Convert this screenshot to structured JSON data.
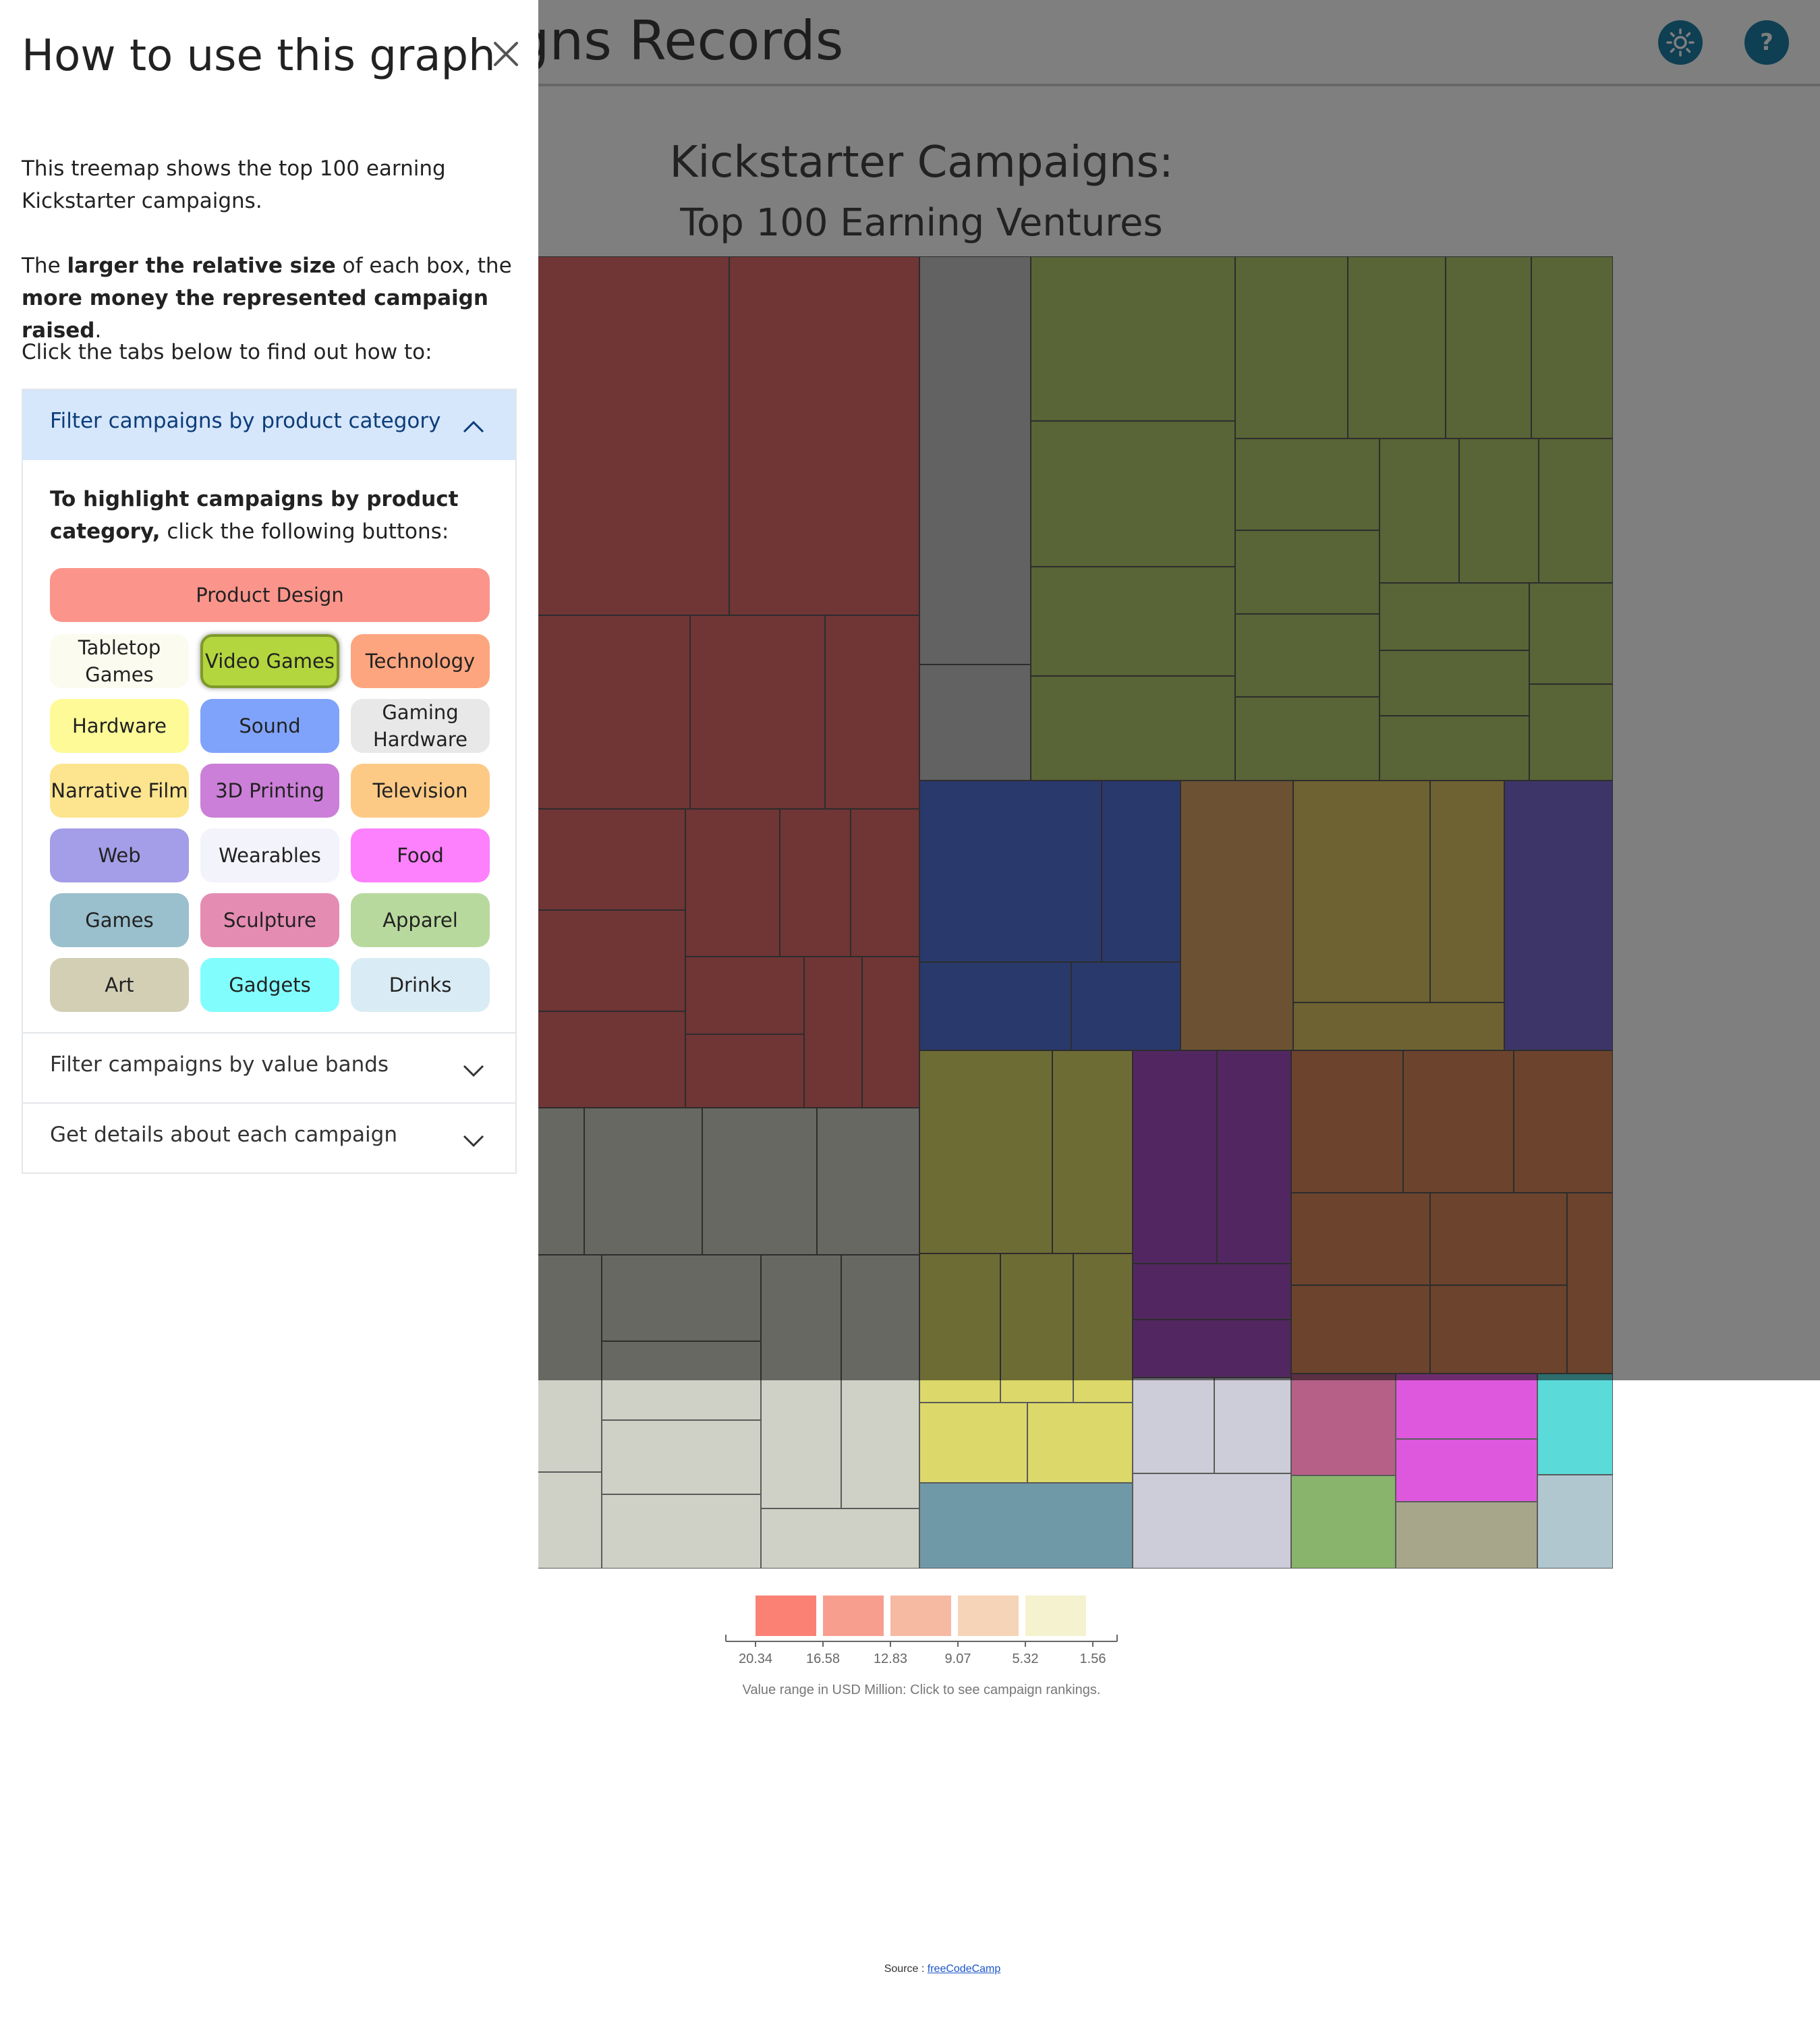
{
  "header": {
    "title": "Kickstarter Campaigns Records",
    "theme_icon": "sun-icon",
    "help_icon": "question-icon",
    "help_label": "?"
  },
  "chart_data": {
    "type": "treemap",
    "title": "Kickstarter Campaigns:",
    "subtitle": "Top 100 Earning Ventures",
    "legend": {
      "ticks": [
        "20.34",
        "16.58",
        "12.83",
        "9.07",
        "5.32",
        "1.56"
      ],
      "colors": [
        "#fa8174",
        "#f89e8f",
        "#f6b9a2",
        "#f6d4b7",
        "#f5f2cf"
      ],
      "caption": "Value range in USD Million: Click to see campaign rankings."
    }
  },
  "source": {
    "prefix": "Source : ",
    "link": "freeCodeCamp"
  },
  "panel": {
    "title": "How to use this graph",
    "close_icon": "close-icon",
    "intro": "This treemap shows the top 100 earning Kickstarter campaigns.",
    "size_prefix": "The ",
    "size_bold1": "larger the relative size",
    "size_mid": " of each box, the ",
    "size_bold2": "more money the represented campaign raised",
    "size_suffix": ".",
    "tabs_intro": "Click the tabs below to find out how to:",
    "accordion": [
      {
        "label": "Filter campaigns by product category",
        "expanded": true,
        "body_bold": "To highlight campaigns by product category,",
        "body_rest": " click the following buttons:"
      },
      {
        "label": "Filter campaigns by value bands",
        "expanded": false
      },
      {
        "label": "Get details about each campaign",
        "expanded": false
      }
    ],
    "categories": [
      {
        "label": "Product Design",
        "color": "#fb958b"
      },
      {
        "label": "Tabletop Games",
        "color": "#fbfbef"
      },
      {
        "label": "Video Games",
        "color": "#b3d63e",
        "selected": true
      },
      {
        "label": "Technology",
        "color": "#fda57f"
      },
      {
        "label": "Hardware",
        "color": "#fdfa97"
      },
      {
        "label": "Sound",
        "color": "#7fa3fb"
      },
      {
        "label": "Gaming Hardware",
        "color": "#e8e8e8"
      },
      {
        "label": "Narrative Film",
        "color": "#fde48e"
      },
      {
        "label": "3D Printing",
        "color": "#cb7fd8"
      },
      {
        "label": "Television",
        "color": "#fdca86"
      },
      {
        "label": "Web",
        "color": "#a49de8"
      },
      {
        "label": "Wearables",
        "color": "#f3f3fb"
      },
      {
        "label": "Food",
        "color": "#fd80fd"
      },
      {
        "label": "Games",
        "color": "#9abfcd"
      },
      {
        "label": "Sculpture",
        "color": "#e58cb3"
      },
      {
        "label": "Apparel",
        "color": "#b8d99d"
      },
      {
        "label": "Art",
        "color": "#d2cfb5"
      },
      {
        "label": "Gadgets",
        "color": "#82fdfd"
      },
      {
        "label": "Drinks",
        "color": "#d9ebf5"
      }
    ]
  }
}
